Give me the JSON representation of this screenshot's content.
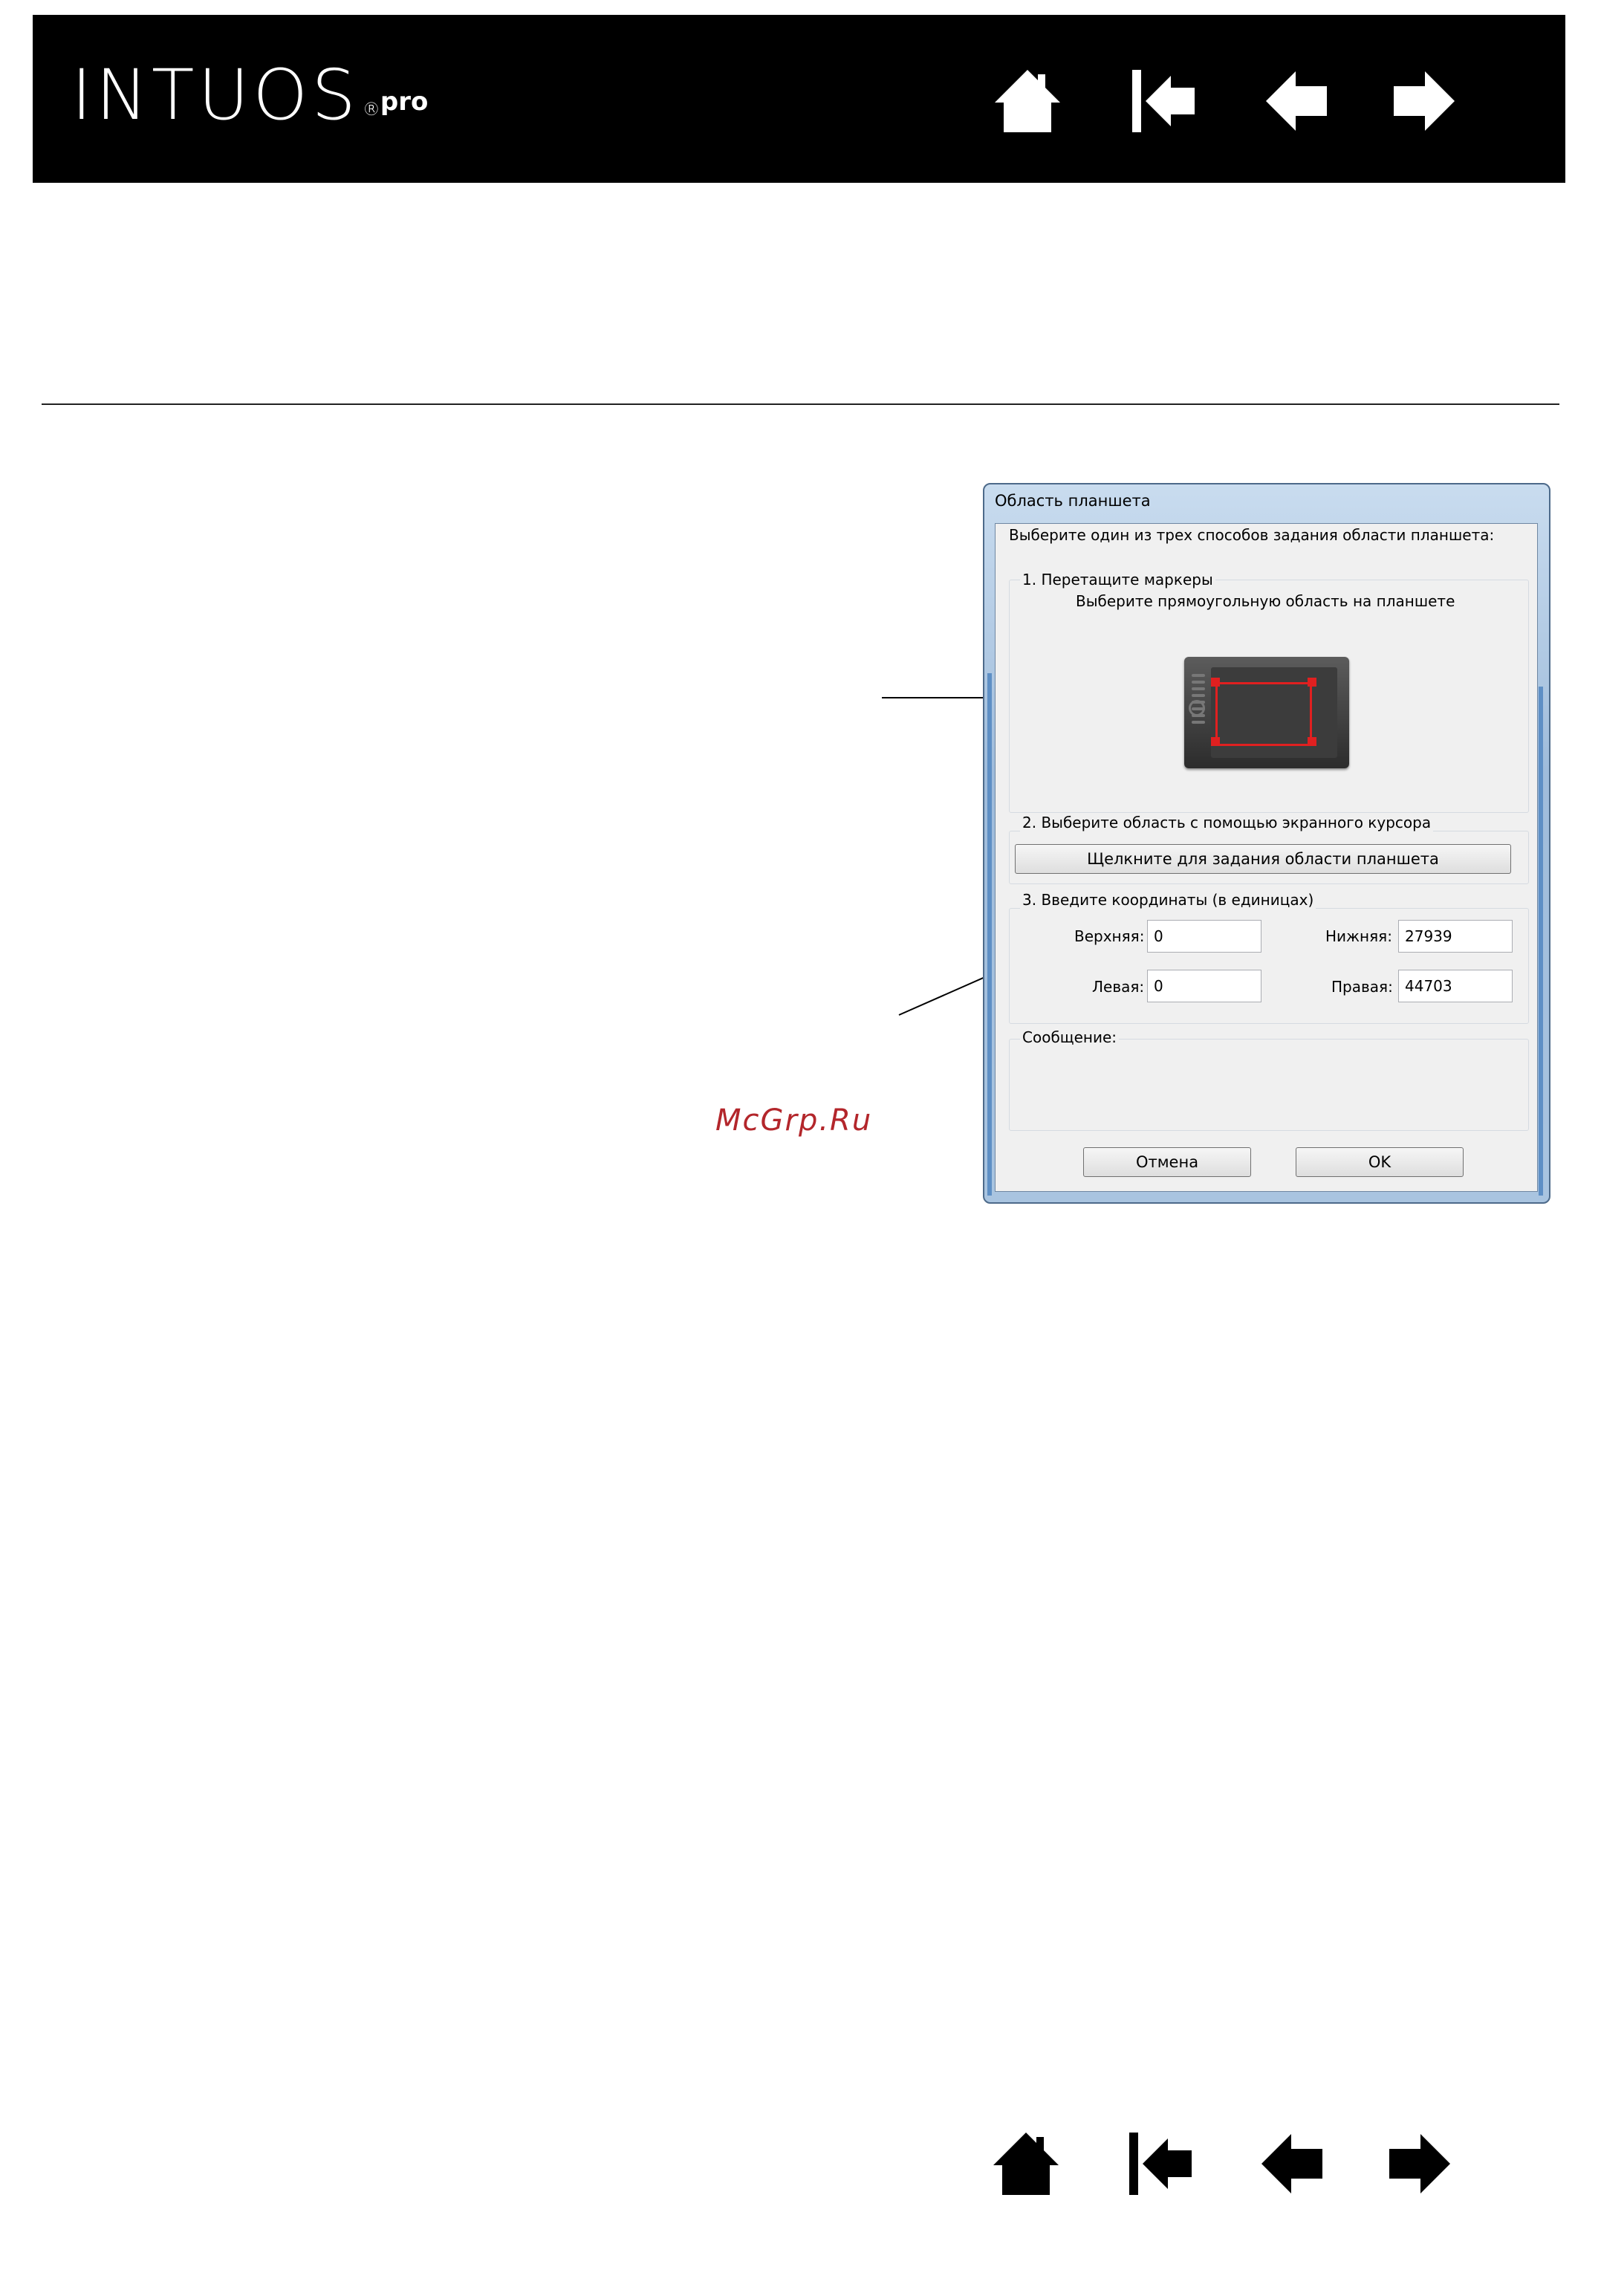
{
  "header": {
    "logo_text": "INTUOS",
    "logo_reg": "®",
    "logo_suffix": "pro",
    "background": "#000000"
  },
  "nav_icons": [
    "home-icon",
    "first-page-icon",
    "previous-page-icon",
    "next-page-icon"
  ],
  "watermark": {
    "text": "McGrp.Ru",
    "color": "#b3262b"
  },
  "dialog": {
    "title": "Область планшета",
    "instruction": "Выберите один из трех способов задания области планшета:",
    "section1": {
      "heading": "1. Перетащите маркеры",
      "subheading": "Выберите прямоугольную область на планшете"
    },
    "section2": {
      "heading": "2. Выберите область с помощью экранного курсора",
      "button_label": "Щелкните для задания области планшета"
    },
    "section3": {
      "heading": "3. Введите координаты (в единицах)",
      "top_label": "Верхняя:",
      "top_value": "0",
      "bottom_label": "Нижняя:",
      "bottom_value": "27939",
      "left_label": "Левая:",
      "left_value": "0",
      "right_label": "Правая:",
      "right_value": "44703"
    },
    "message_label": "Сообщение:",
    "cancel_label": "Отмена",
    "ok_label": "OK"
  }
}
